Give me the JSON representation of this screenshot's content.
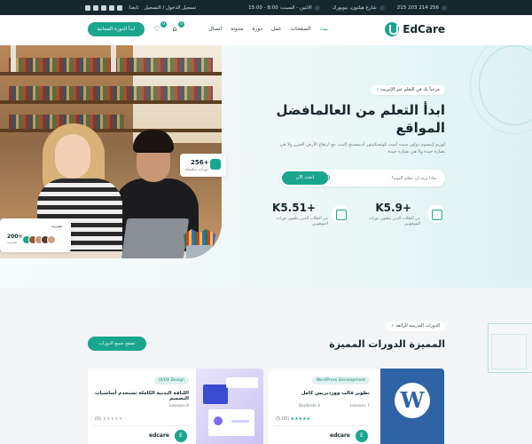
{
  "topbar": {
    "phone": "256 214 203 215",
    "address": "شارع هيلتون، نيويورك",
    "hours": "الاثنين - السبت: 8:00 - 15:00",
    "login": "تسجيل الدخول / التسجيل",
    "follow": "تابعنا:",
    "social_icons": [
      "facebook-icon",
      "x-icon",
      "pinterest-icon",
      "instagram-icon",
      "youtube-icon"
    ]
  },
  "header": {
    "logo": "EdCare",
    "nav": [
      "بيت",
      "الصفحات",
      "عمل",
      "دورة",
      "مدونة",
      "اتصال"
    ],
    "cart_count": "0",
    "wishlist_count": "0",
    "cta": "ابدأ الدورة المجانية"
  },
  "hero": {
    "eyebrow": "مرحباً بك في التعلم عبر الإنترنت",
    "title": "ابدأ التعلم من العالمافضل المواقع",
    "description": "لوريم إيبسوم دولور سيت أميت كونسكتيتور أديبيسينج إليت. مع ارتفاع الأرض الحزن ولا هي نضارة جيدة ولا هي نضارة جيدة",
    "search_placeholder": "ماذا تريد أن تتعلم اليوم؟",
    "search_button": "ابحث الآن",
    "stats": [
      {
        "value": "+K5.9",
        "label": "من الطلاب الذين يتلقون دورات الموهوبين"
      },
      {
        "value": "+K5.51",
        "label": "من الطلاب الذين يتلقون دورات الموهوبين"
      }
    ],
    "courses_card": {
      "value": "256+",
      "label": "دورات مكتملة"
    },
    "trainers_card": {
      "title": "مدرب",
      "value": "200+",
      "label": "مدرب"
    }
  },
  "featured": {
    "eyebrow": "الدورات التدريبية الرائعة",
    "title": "المميزة الدورات المميزة",
    "button": "تصفح جميع الدورات",
    "courses": [
      {
        "tag": "UI/UX Design",
        "title": "اللياقة البدنية الكاملة تستخدم أساسيات التصميم",
        "lessons": "Lessons 8",
        "rating_count": "(0)",
        "rating": 0,
        "brand": "edcare"
      },
      {
        "tag": "WordPress Development",
        "title": "تطوير قالب ووردبريس كامل",
        "lessons": "Lessons 7",
        "students": "Students 4",
        "rating_count": "(5.00)",
        "rating": 5,
        "brand": "edcare"
      }
    ]
  },
  "colors": {
    "accent": "#1aa58f",
    "dark": "#16282e"
  }
}
